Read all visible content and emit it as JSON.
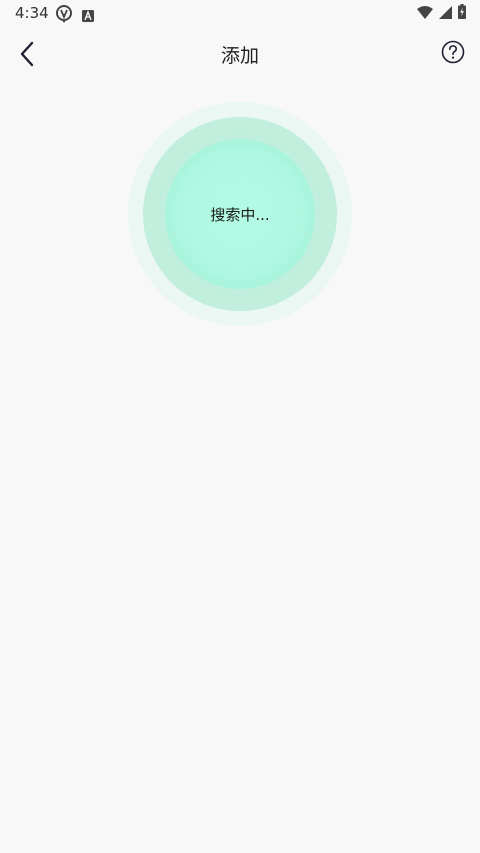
{
  "status_bar": {
    "time": "4:34"
  },
  "header": {
    "title": "添加"
  },
  "radar": {
    "status_text": "搜索中..."
  },
  "colors": {
    "background": "#f8f8f8",
    "accent_inner": "#b0f7e1",
    "accent_mid": "#c2eedd",
    "accent_outer": "#eaf7f2"
  },
  "icons": {
    "back": "chevron-left-icon",
    "help": "question-circle-icon"
  }
}
